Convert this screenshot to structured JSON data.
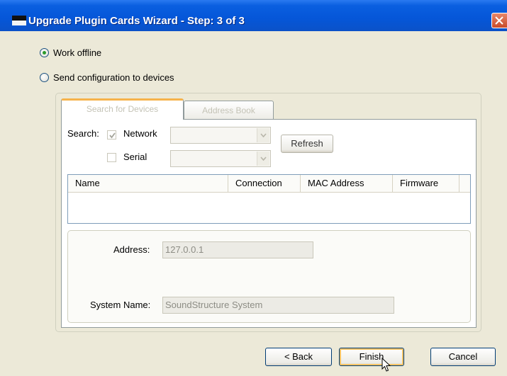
{
  "window": {
    "title": "Upgrade Plugin Cards Wizard - Step: 3 of 3"
  },
  "mode": {
    "work_offline": {
      "label": "Work offline",
      "selected": true
    },
    "send_config": {
      "label": "Send configuration to devices",
      "selected": false
    }
  },
  "tabs": {
    "search": "Search for Devices",
    "address_book": "Address Book"
  },
  "search": {
    "label": "Search:",
    "network": {
      "label": "Network",
      "checked": true
    },
    "serial": {
      "label": "Serial",
      "checked": false
    },
    "refresh_label": "Refresh"
  },
  "device_list": {
    "columns": [
      "Name",
      "Connection",
      "MAC Address",
      "Firmware"
    ]
  },
  "details": {
    "address_label": "Address:",
    "address_value": "127.0.0.1",
    "system_name_label": "System Name:",
    "system_name_value": "SoundStructure System"
  },
  "footer": {
    "back_label": "< Back",
    "finish_label": "Finish",
    "cancel_label": "Cancel"
  }
}
